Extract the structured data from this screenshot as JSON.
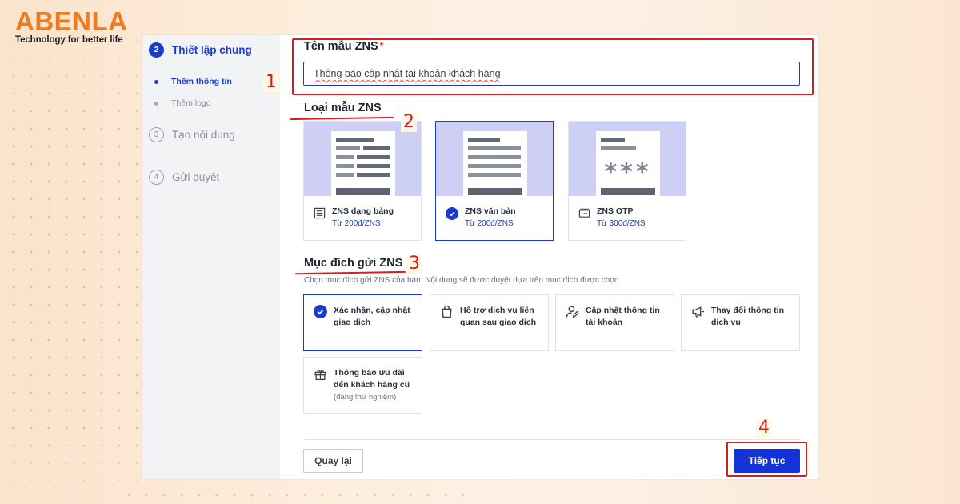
{
  "brand": {
    "name": "ABENLA",
    "tagline": "Technology for better life",
    "color": "#f07a1e"
  },
  "sidebar": {
    "steps": [
      {
        "num": "2",
        "label": "Thiết lập chung",
        "state": "active"
      },
      {
        "num": "3",
        "label": "Tạo nội dung",
        "state": "idle"
      },
      {
        "num": "4",
        "label": "Gửi duyệt",
        "state": "idle"
      }
    ],
    "substeps": [
      {
        "label": "Thêm thông tin",
        "state": "active"
      },
      {
        "label": "Thêm logo",
        "state": "idle"
      }
    ]
  },
  "form": {
    "name_label": "Tên mẫu ZNS",
    "required_mark": "*",
    "name_value": "Thông báo cập nhật tài khoản khách hàng",
    "type_label": "Loại mẫu ZNS",
    "types": [
      {
        "title": "ZNS dạng bảng",
        "price": "Từ 200đ/ZNS",
        "icon": "table-icon",
        "selected": false
      },
      {
        "title": "ZNS văn bản",
        "price": "Từ 200đ/ZNS",
        "icon": "check-icon",
        "selected": true
      },
      {
        "title": "ZNS OTP",
        "price": "Từ 300đ/ZNS",
        "icon": "otp-icon",
        "selected": false
      }
    ],
    "otp_stars": "***",
    "purpose_label": "Mục đích gửi ZNS",
    "purpose_hint": "Chọn mục đích gửi ZNS của bạn. Nội dung sẽ được duyệt dựa trên mục đích được chọn.",
    "purposes": [
      {
        "lines": [
          "Xác nhận, cập nhật",
          "giao dịch"
        ],
        "icon": "check-icon",
        "selected": true
      },
      {
        "lines": [
          "Hỗ trợ dịch vụ liên",
          "quan sau giao dịch"
        ],
        "icon": "shopping-bag-icon",
        "selected": false
      },
      {
        "lines": [
          "Cập nhật thông tin",
          "tài khoản"
        ],
        "icon": "user-edit-icon",
        "selected": false
      },
      {
        "lines": [
          "Thay đổi thông tin",
          "dịch vụ"
        ],
        "icon": "megaphone-icon",
        "selected": false
      },
      {
        "lines": [
          "Thông báo ưu đãi",
          "đến khách hàng cũ"
        ],
        "note": "(đang thử nghiệm)",
        "icon": "gift-icon",
        "selected": false
      }
    ]
  },
  "footer": {
    "back_label": "Quay lại",
    "next_label": "Tiếp tục"
  },
  "annotations": [
    "1",
    "2",
    "3",
    "4"
  ],
  "colors": {
    "primary": "#1b3cc8",
    "annotation": "#d21f1f",
    "card_header": "#cdd0f4"
  }
}
